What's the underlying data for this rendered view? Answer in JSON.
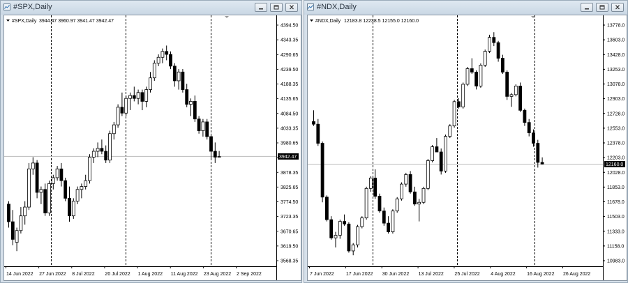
{
  "windows": [
    {
      "id": "spx",
      "title": "#SPX,Daily",
      "header_symbol": "#SPX,Daily",
      "header_ohlc": "3944.47 3960.97 3941.47 3942.47",
      "current_price_label": "3942.47",
      "y_ticks": [
        "4394.50",
        "4343.35",
        "4290.65",
        "4239.50",
        "4188.35",
        "4135.65",
        "4084.50",
        "4033.35",
        "3980.65",
        "3929.50",
        "3878.35",
        "3825.65",
        "3774.50",
        "3723.35",
        "3670.65",
        "3619.50",
        "3568.35"
      ],
      "x_ticks": [
        "14 Jun 2022",
        "27 Jun 2022",
        "8 Jul 2022",
        "20 Jul 2022",
        "1 Aug 2022",
        "11 Aug 2022",
        "23 Aug 2022",
        "2 Sep 2022"
      ]
    },
    {
      "id": "ndx",
      "title": "#NDX,Daily",
      "header_symbol": "#NDX,Daily",
      "header_ohlc": "12183.8 12238.5 12155.0 12160.0",
      "current_price_label": "12160.0",
      "y_ticks": [
        "13778.0",
        "13603.0",
        "13428.0",
        "13253.0",
        "13078.0",
        "12903.0",
        "12728.0",
        "12553.0",
        "12378.0",
        "12203.0",
        "12028.0",
        "11853.0",
        "11678.0",
        "11503.0",
        "11333.0",
        "11158.0",
        "10983.0"
      ],
      "x_ticks": [
        "7 Jun 2022",
        "17 Jun 2022",
        "30 Jun 2022",
        "13 Jul 2022",
        "25 Jul 2022",
        "4 Aug 2022",
        "16 Aug 2022",
        "26 Aug 2022"
      ]
    }
  ],
  "icons": [
    "chart-app-icon",
    "minimize-icon",
    "restore-icon",
    "close-icon",
    "dropdown-triangle-icon"
  ],
  "colors": {
    "bull_body": "#ffffff",
    "bear_body": "#000000",
    "grid": "#000000",
    "price_line": "#bcbcbc",
    "window_bg": "#d6e0ea"
  },
  "chart_data": [
    {
      "type": "candlestick",
      "name": "#SPX,Daily",
      "ylim": [
        3568.35,
        4394.5
      ],
      "price_line": 3942.47,
      "candles": [
        [
          3780,
          3790,
          3700,
          3720
        ],
        [
          3720,
          3760,
          3640,
          3660
        ],
        [
          3650,
          3700,
          3620,
          3690
        ],
        [
          3690,
          3770,
          3680,
          3740
        ],
        [
          3740,
          3790,
          3710,
          3770
        ],
        [
          3770,
          3920,
          3760,
          3900
        ],
        [
          3900,
          3940,
          3880,
          3920
        ],
        [
          3920,
          3930,
          3800,
          3820
        ],
        [
          3820,
          3840,
          3780,
          3830
        ],
        [
          3830,
          3850,
          3740,
          3750
        ],
        [
          3750,
          3860,
          3740,
          3850
        ],
        [
          3850,
          3880,
          3830,
          3870
        ],
        [
          3870,
          3910,
          3860,
          3900
        ],
        [
          3900,
          3920,
          3840,
          3860
        ],
        [
          3860,
          3870,
          3790,
          3800
        ],
        [
          3800,
          3840,
          3720,
          3740
        ],
        [
          3740,
          3800,
          3730,
          3790
        ],
        [
          3790,
          3840,
          3780,
          3830
        ],
        [
          3830,
          3850,
          3800,
          3840
        ],
        [
          3840,
          3880,
          3830,
          3860
        ],
        [
          3860,
          3950,
          3850,
          3940
        ],
        [
          3940,
          3970,
          3920,
          3960
        ],
        [
          3960,
          3990,
          3940,
          3970
        ],
        [
          3970,
          4000,
          3950,
          3960
        ],
        [
          3960,
          3980,
          3920,
          3930
        ],
        [
          3930,
          4030,
          3920,
          4020
        ],
        [
          4020,
          4060,
          4000,
          4050
        ],
        [
          4050,
          4120,
          4040,
          4110
        ],
        [
          4110,
          4160,
          4080,
          4090
        ],
        [
          4090,
          4150,
          4080,
          4140
        ],
        [
          4140,
          4160,
          4100,
          4150
        ],
        [
          4150,
          4180,
          4130,
          4140
        ],
        [
          4140,
          4170,
          4120,
          4160
        ],
        [
          4160,
          4170,
          4100,
          4130
        ],
        [
          4130,
          4180,
          4110,
          4170
        ],
        [
          4170,
          4230,
          4160,
          4210
        ],
        [
          4210,
          4270,
          4200,
          4260
        ],
        [
          4260,
          4290,
          4250,
          4280
        ],
        [
          4280,
          4310,
          4260,
          4300
        ],
        [
          4300,
          4320,
          4270,
          4290
        ],
        [
          4290,
          4300,
          4240,
          4250
        ],
        [
          4250,
          4260,
          4180,
          4200
        ],
        [
          4200,
          4240,
          4170,
          4230
        ],
        [
          4230,
          4240,
          4160,
          4170
        ],
        [
          4170,
          4190,
          4110,
          4120
        ],
        [
          4120,
          4140,
          4080,
          4130
        ],
        [
          4130,
          4150,
          4060,
          4070
        ],
        [
          4070,
          4080,
          4020,
          4030
        ],
        [
          4030,
          4070,
          4010,
          4060
        ],
        [
          4060,
          4070,
          4000,
          4010
        ],
        [
          4010,
          4020,
          3930,
          3960
        ],
        [
          3960,
          3990,
          3920,
          3940
        ],
        [
          3940,
          3961,
          3941,
          3942
        ]
      ]
    },
    {
      "type": "candlestick",
      "name": "#NDX,Daily",
      "ylim": [
        10983.0,
        13778.0
      ],
      "price_line": 12160.0,
      "candles": [
        [
          12650,
          12780,
          12600,
          12620
        ],
        [
          12620,
          12680,
          12370,
          12400
        ],
        [
          12400,
          12420,
          11720,
          11780
        ],
        [
          11780,
          11800,
          11500,
          11520
        ],
        [
          11520,
          11560,
          11290,
          11310
        ],
        [
          11310,
          11380,
          11200,
          11340
        ],
        [
          11340,
          11520,
          11300,
          11500
        ],
        [
          11500,
          11580,
          11450,
          11470
        ],
        [
          11470,
          11490,
          11140,
          11160
        ],
        [
          11160,
          11250,
          11110,
          11230
        ],
        [
          11230,
          11460,
          11200,
          11440
        ],
        [
          11440,
          11560,
          11420,
          11540
        ],
        [
          11540,
          11900,
          11520,
          11880
        ],
        [
          11880,
          12020,
          11840,
          12000
        ],
        [
          12000,
          12100,
          11760,
          11790
        ],
        [
          11790,
          11820,
          11600,
          11620
        ],
        [
          11620,
          11660,
          11450,
          11480
        ],
        [
          11480,
          11560,
          11360,
          11380
        ],
        [
          11380,
          11640,
          11360,
          11620
        ],
        [
          11620,
          11780,
          11600,
          11760
        ],
        [
          11760,
          11950,
          11740,
          11930
        ],
        [
          11930,
          12060,
          11900,
          12040
        ],
        [
          12040,
          12080,
          11820,
          11840
        ],
        [
          11840,
          11900,
          11680,
          11700
        ],
        [
          11700,
          11760,
          11500,
          11720
        ],
        [
          11720,
          11900,
          11700,
          11880
        ],
        [
          11880,
          12220,
          11860,
          12200
        ],
        [
          12200,
          12380,
          12180,
          12360
        ],
        [
          12360,
          12460,
          12300,
          12300
        ],
        [
          12300,
          12340,
          12040,
          12080
        ],
        [
          12080,
          12500,
          12060,
          12480
        ],
        [
          12480,
          12620,
          12460,
          12600
        ],
        [
          12600,
          12900,
          12580,
          12880
        ],
        [
          12880,
          12920,
          12800,
          12820
        ],
        [
          12820,
          13100,
          12800,
          13080
        ],
        [
          13080,
          13280,
          13060,
          13260
        ],
        [
          13260,
          13380,
          13200,
          13220
        ],
        [
          13220,
          13240,
          13020,
          13060
        ],
        [
          13060,
          13320,
          13040,
          13300
        ],
        [
          13300,
          13480,
          13280,
          13460
        ],
        [
          13460,
          13650,
          13440,
          13620
        ],
        [
          13620,
          13680,
          13520,
          13560
        ],
        [
          13560,
          13580,
          13340,
          13380
        ],
        [
          13380,
          13420,
          13200,
          13220
        ],
        [
          13220,
          13240,
          12900,
          12940
        ],
        [
          12940,
          12980,
          12820,
          12960
        ],
        [
          12960,
          13080,
          12940,
          13060
        ],
        [
          13060,
          13100,
          12760,
          12780
        ],
        [
          12780,
          12800,
          12600,
          12640
        ],
        [
          12640,
          12680,
          12480,
          12520
        ],
        [
          12520,
          12560,
          12360,
          12400
        ],
        [
          12400,
          12440,
          12120,
          12180
        ],
        [
          12180,
          12238,
          12155,
          12160
        ]
      ]
    }
  ]
}
